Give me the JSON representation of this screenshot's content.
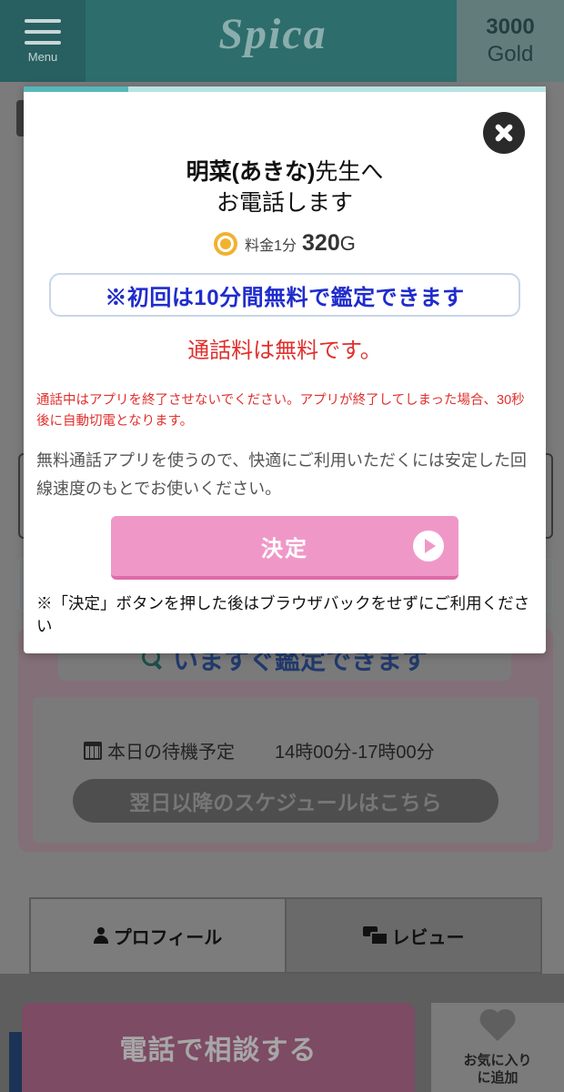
{
  "header": {
    "menu_label": "Menu",
    "logo_text": "Spica",
    "gold_amount": "3000",
    "gold_unit": "Gold"
  },
  "background": {
    "search_button": "いますぐ鑑定できます",
    "schedule_label": "本日の待機予定",
    "schedule_time": "14時00分-17時00分",
    "schedule_link": "翌日以降のスケジュールはこちら",
    "tabs": [
      "プロフィール",
      "レビュー"
    ],
    "call_button": "電話で相談する",
    "favorite_line1": "お気に入り",
    "favorite_line2": "に追加"
  },
  "modal": {
    "progress": 0.2,
    "title_name": "明菜(あきな)",
    "title_suffix": "先生へ",
    "title_line2": "お電話します",
    "fee_label": "料金1分",
    "fee_value": "320",
    "fee_unit": "G",
    "free_trial": "※初回は10分間無料で鑑定できます",
    "free_call": "通話料は無料です。",
    "warning": "通話中はアプリを終了させないでください。アプリが終了してしまった場合、30秒後に自動切電となります。",
    "notice": "無料通話アプリを使うので、快適にご利用いただくには安定した回線速度のもとでお使いください。",
    "decide_button": "決定",
    "footnote": "※「決定」ボタンを押した後はブラウザバックをせずにご利用ください"
  },
  "colors": {
    "header_bg": "#2d6d6c",
    "decide_button": "#ef98c8",
    "free_trial_text": "#1f2ccc",
    "warning_text": "#e0302d",
    "progress_fill": "#56b7b9"
  }
}
